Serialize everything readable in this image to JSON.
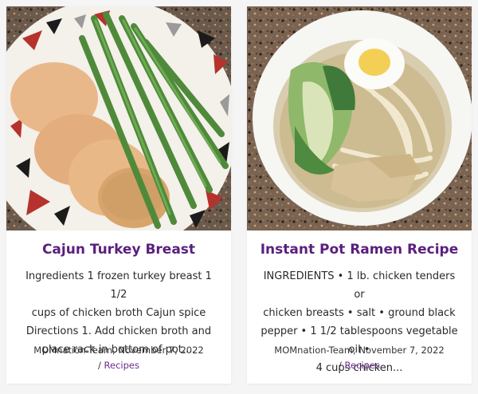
{
  "posts": [
    {
      "title": "Cajun Turkey Breast",
      "excerpt_lines": [
        "Ingredients 1 frozen turkey breast 1 1/2",
        "cups of chicken broth Cajun spice",
        "Directions 1. Add chicken broth and",
        "place rack in bottom of pot...."
      ],
      "byline": "MOMnation-Team, November 7, 2022",
      "separator": "/",
      "category": "Recipes"
    },
    {
      "title": "Instant Pot Ramen Recipe",
      "excerpt_lines": [
        "INGREDIENTS • 1 lb. chicken tenders or",
        "chicken breasts • salt • ground black",
        "pepper • 1 1/2 tablespoons vegetable oil •",
        "4 cups chicken..."
      ],
      "byline": "MOMnation-Team, November 7, 2022",
      "separator": "/",
      "category": "Recipes"
    }
  ],
  "colors": {
    "title": "#5a1f7e",
    "category_link": "#6b2d8f",
    "text": "#2a2a2a"
  }
}
